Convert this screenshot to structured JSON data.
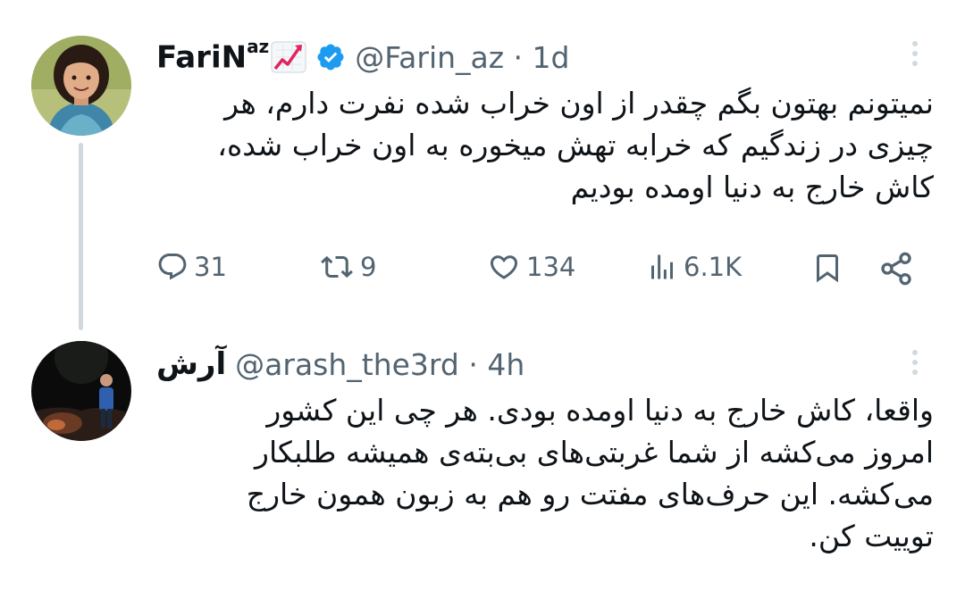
{
  "tweet1": {
    "display_name": "FariN",
    "display_name_sup": "az",
    "display_name_emoji": "📈",
    "verified": true,
    "handle_line": "@Farin_az · 1d",
    "text": "نمیتونم بهتون بگم چقدر از اون خراب شده نفرت دارم، هر\nچیزی در زندگیم که خرابه تهش میخوره به اون خراب شده،\nکاش خارج به دنیا اومده بودیم",
    "actions": {
      "replies": "31",
      "retweets": "9",
      "likes": "134",
      "views": "6.1K"
    }
  },
  "tweet2": {
    "display_name": "آرش",
    "handle_line": "@arash_the3rd · 4h",
    "text": "واقعا، کاش خارج به دنیا اومده بودی. هر چی این کشور\nامروز می‌کشه از شما غربتی‌های بی‌بته‌ی همیشه طلبکار\nمی‌کشه. این حرف‌های مفتت رو هم به زبون همون خارج\nتوییت کن."
  },
  "colors": {
    "text_primary": "#0f1419",
    "text_secondary": "#536471",
    "verified_blue": "#1d9bf0",
    "thread_line": "#cfd9de"
  },
  "icons": [
    "reply-icon",
    "retweet-icon",
    "like-icon",
    "views-icon",
    "bookmark-icon",
    "share-icon",
    "more-icon",
    "verified-badge-icon",
    "chart-increasing-emoji"
  ]
}
